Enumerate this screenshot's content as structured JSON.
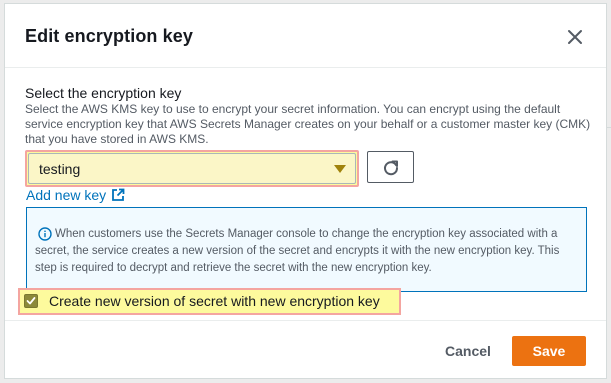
{
  "modal": {
    "title": "Edit encryption key"
  },
  "encryption": {
    "label": "Select the encryption key",
    "description": "Select the AWS KMS key to use to encrypt your secret information. You can encrypt using the default service encryption key that AWS Secrets Manager creates on your behalf or a customer master key (CMK) that you have stored in AWS KMS.",
    "selected_key": "testing",
    "add_new_key_label": "Add new key"
  },
  "info": {
    "text": "When customers use the Secrets Manager console to change the encryption key associated with a secret, the service creates a new version of the secret and encrypts it with the new encryption key. This step is required to decrypt and retrieve the secret with the new encryption key."
  },
  "checkbox": {
    "label": "Create new version of secret with new encryption key",
    "checked": true
  },
  "footer": {
    "cancel_label": "Cancel",
    "save_label": "Save"
  },
  "colors": {
    "primary": "#ec7211",
    "link": "#0073bb",
    "info_border": "#0073bb",
    "highlight": "#fdfa9d"
  },
  "icons": [
    "close-icon",
    "caret-down-icon",
    "refresh-icon",
    "external-link-icon",
    "info-icon",
    "checkmark-icon"
  ]
}
